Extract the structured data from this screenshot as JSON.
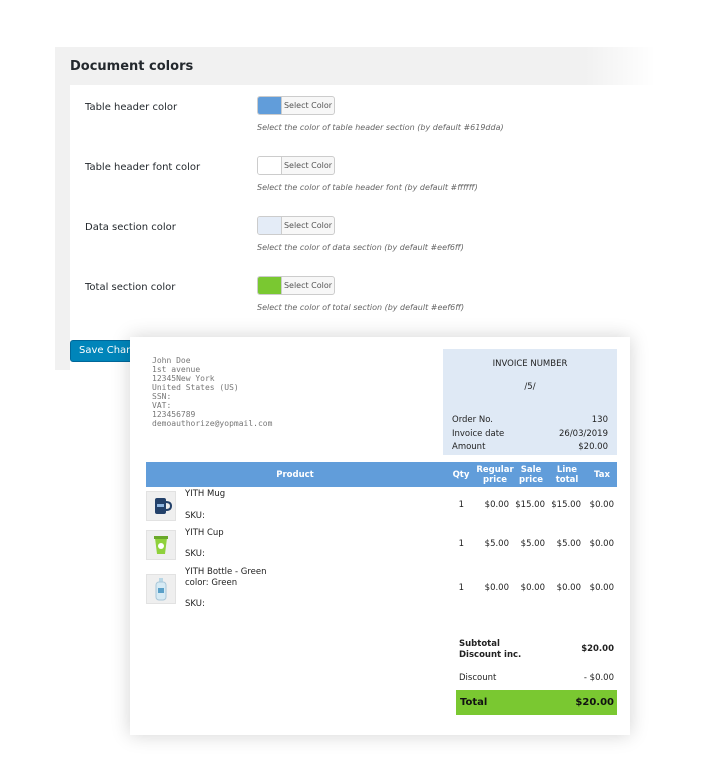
{
  "settings": {
    "title": "Document colors",
    "picker_label": "Select Color",
    "options": [
      {
        "label": "Table header color",
        "swatch": "#619dda",
        "desc": "Select the color of table header section (by default #619dda)"
      },
      {
        "label": "Table header font color",
        "swatch": "#ffffff",
        "desc": "Select the color of table header font (by default #ffffff)"
      },
      {
        "label": "Data section color",
        "swatch": "#eef6ff",
        "desc": "Select the color of data section (by default #eef6ff)"
      },
      {
        "label": "Total section color",
        "swatch": "#7ac831",
        "desc": "Select the color of total section (by default #eef6ff)"
      }
    ],
    "save_label": "Save Changes"
  },
  "invoice": {
    "address": [
      "John Doe",
      "1st avenue",
      "12345New York",
      "United States (US)",
      "SSN:",
      "VAT:",
      "123456789",
      "demoauthorize@yopmail.com"
    ],
    "heading": "INVOICE NUMBER",
    "number": "/5/",
    "meta": [
      {
        "label": "Order No.",
        "value": "130"
      },
      {
        "label": "Invoice date",
        "value": "26/03/2019"
      },
      {
        "label": "Amount",
        "value": "$20.00"
      }
    ],
    "columns": {
      "product": "Product",
      "qty": "Qty",
      "regular": "Regular price",
      "sale": "Sale price",
      "line": "Line total",
      "tax": "Tax"
    },
    "items": [
      {
        "name": "YITH Mug",
        "attr": "",
        "sku": "SKU:",
        "qty": "1",
        "regular": "$0.00",
        "sale": "$15.00",
        "line": "$15.00",
        "tax": "$0.00",
        "icon": "mug-image"
      },
      {
        "name": "YITH Cup",
        "attr": "",
        "sku": "SKU:",
        "qty": "1",
        "regular": "$5.00",
        "sale": "$5.00",
        "line": "$5.00",
        "tax": "$0.00",
        "icon": "cup-image"
      },
      {
        "name": "YITH Bottle - Green",
        "attr": "color: Green",
        "sku": "SKU:",
        "qty": "1",
        "regular": "$0.00",
        "sale": "$0.00",
        "line": "$0.00",
        "tax": "$0.00",
        "icon": "bottle-image"
      }
    ],
    "totals": {
      "subtotal_label": "Subtotal",
      "discount_inc_label": "Discount inc.",
      "subtotal_value": "$20.00",
      "discount_label": "Discount",
      "discount_value": "- $0.00",
      "total_label": "Total",
      "total_value": "$20.00"
    },
    "colors": {
      "header": "#619dda",
      "data": "#dfe9f5",
      "total": "#7ac831"
    }
  }
}
